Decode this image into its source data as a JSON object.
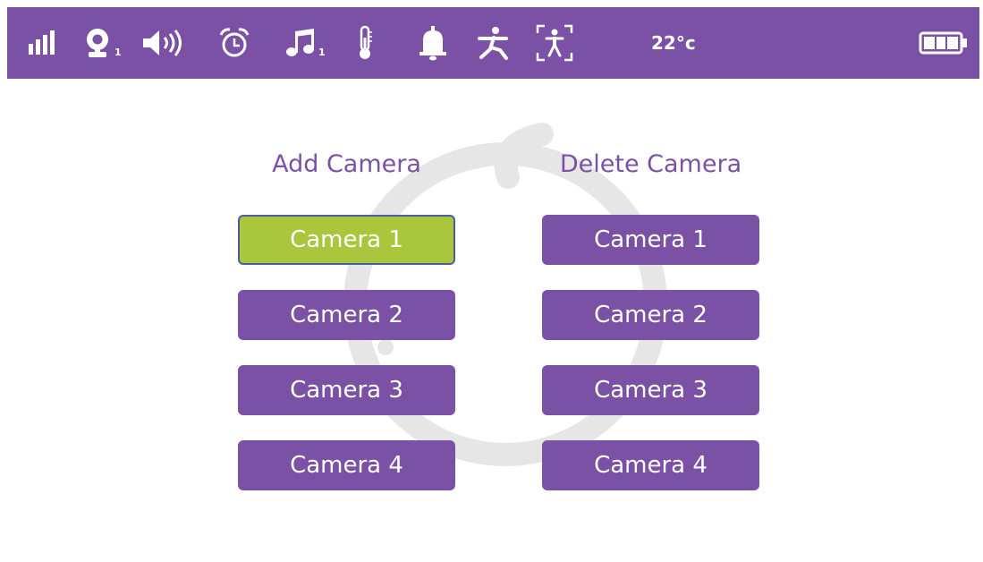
{
  "status_bar": {
    "signal_icon": "signal-bars-icon",
    "camera_icon": "baby-camera-icon",
    "camera_number": "1",
    "volume_icon": "speaker-volume-icon",
    "alarm_icon": "alarm-clock-icon",
    "music_icon": "music-note-icon",
    "music_number": "1",
    "thermometer_icon": "thermometer-icon",
    "bell_icon": "bell-icon",
    "motion_icon": "motion-person-icon",
    "zoom_icon": "focus-frame-person-icon",
    "temperature": "22°c",
    "battery_icon": "battery-icon",
    "battery_level": 1.0
  },
  "add_column": {
    "title": "Add Camera",
    "buttons": [
      "Camera 1",
      "Camera 2",
      "Camera 3",
      "Camera 4"
    ],
    "selected_index": 0
  },
  "delete_column": {
    "title": "Delete Camera",
    "buttons": [
      "Camera 1",
      "Camera 2",
      "Camera 3",
      "Camera 4"
    ]
  },
  "colors": {
    "primary": "#7a51a5",
    "selected": "#a9c63d",
    "selected_border": "#4a5fa0",
    "watermark": "#e6e6e6",
    "text_on_primary": "#ffffff"
  }
}
